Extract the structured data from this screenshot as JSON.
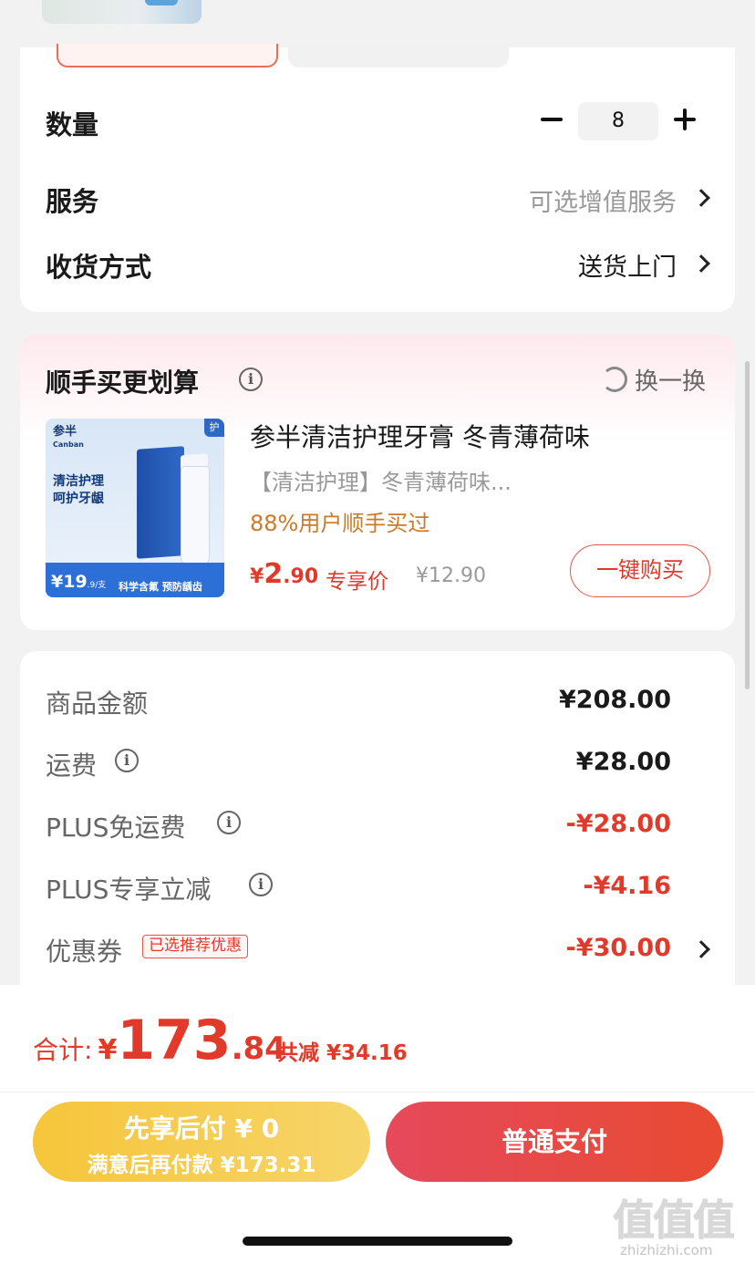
{
  "quantity": {
    "label": "数量",
    "value": "8"
  },
  "service": {
    "label": "服务",
    "value": "可选增值服务"
  },
  "delivery": {
    "label": "收货方式",
    "value": "送货上门"
  },
  "recommend": {
    "title": "顺手买更划算",
    "refresh_label": "换一换",
    "product": {
      "title": "参半清洁护理牙膏 冬青薄荷味",
      "subtitle": "【清洁护理】冬青薄荷味...",
      "buyers": "88%用户顺手买过",
      "price_currency": "¥",
      "price_int": "2",
      "price_dec": ".90",
      "price_tag": "专享价",
      "original_price": "¥12.90",
      "buy_button": "一键购买",
      "image": {
        "brand": "参半",
        "brand_en": "Canban",
        "headline_1": "清洁护理",
        "headline_2": "呵护牙龈",
        "corner_tag": "护",
        "price": "¥19",
        "price_unit": ".9/支",
        "features": "科学含氟  预防龋齿"
      }
    }
  },
  "summary": {
    "rows": [
      {
        "label": "商品金额",
        "value": "¥208.00"
      },
      {
        "label": "运费",
        "value": "¥28.00"
      },
      {
        "label": "PLUS免运费",
        "value": "-¥28.00"
      },
      {
        "label": "PLUS专享立减",
        "value": "-¥4.16"
      },
      {
        "label": "优惠券",
        "value": "-¥30.00"
      }
    ],
    "coupon_badge": "已选推荐优惠"
  },
  "footer": {
    "total_label": "合计:",
    "total_currency": "¥",
    "total_int": "173",
    "total_dec": ".84",
    "saved": "共减 ¥34.16",
    "later_line1": "先享后付 ¥ 0",
    "later_line2": "满意后再付款 ¥173.31",
    "pay_button": "普通支付"
  },
  "watermark": {
    "text": "值值值",
    "domain": "zhizhizhi.com"
  },
  "colors": {
    "accent_red": "#e23a2a",
    "gold": "#f6c53a",
    "buyers_orange": "#cc7a2a"
  }
}
